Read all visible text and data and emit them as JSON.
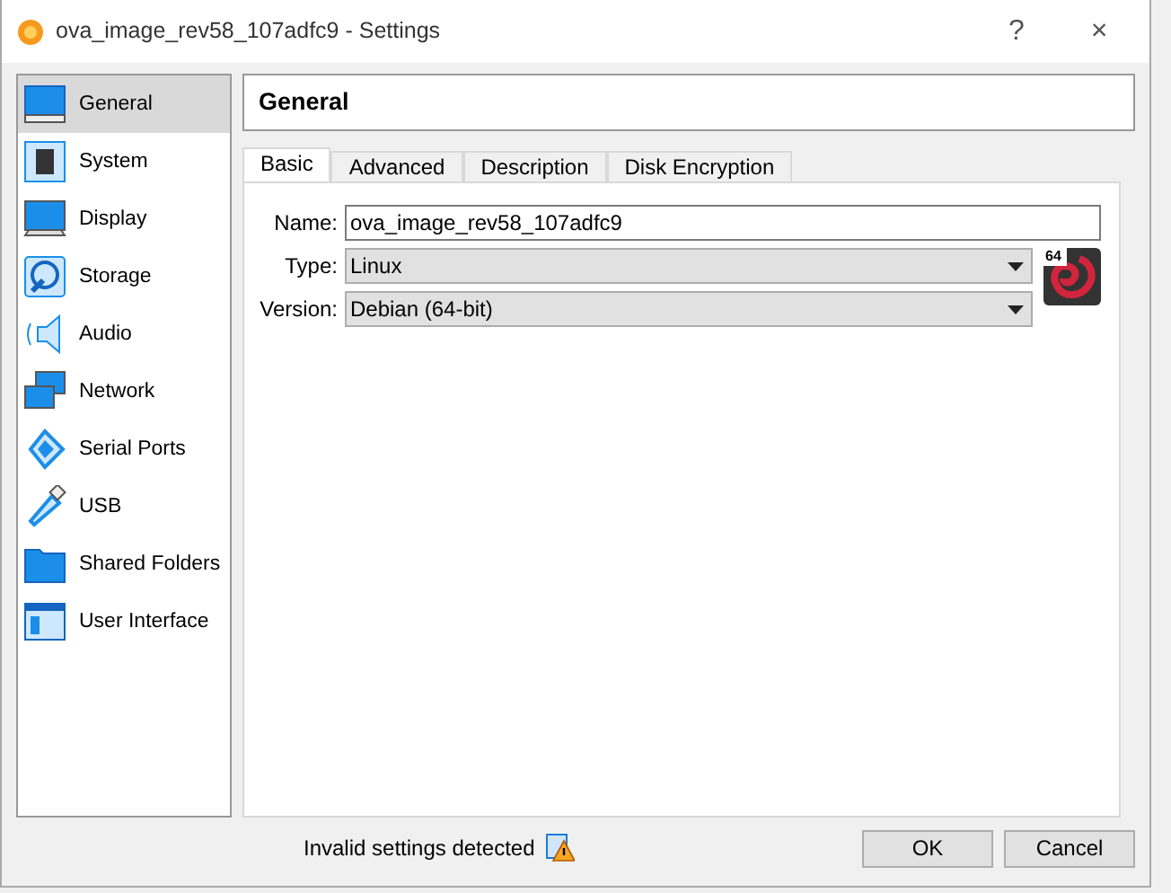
{
  "window": {
    "title": "ova_image_rev58_107adfc9 - Settings",
    "help": "?",
    "close": "×"
  },
  "sidebar": {
    "items": [
      {
        "label": "General",
        "selected": true
      },
      {
        "label": "System",
        "selected": false
      },
      {
        "label": "Display",
        "selected": false
      },
      {
        "label": "Storage",
        "selected": false
      },
      {
        "label": "Audio",
        "selected": false
      },
      {
        "label": "Network",
        "selected": false
      },
      {
        "label": "Serial Ports",
        "selected": false
      },
      {
        "label": "USB",
        "selected": false
      },
      {
        "label": "Shared Folders",
        "selected": false
      },
      {
        "label": "User Interface",
        "selected": false
      }
    ]
  },
  "page_title": "General",
  "tabs": [
    {
      "label": "Basic",
      "selected": true
    },
    {
      "label": "Advanced",
      "selected": false
    },
    {
      "label": "Description",
      "selected": false
    },
    {
      "label": "Disk Encryption",
      "selected": false
    }
  ],
  "fields": [
    {
      "kind": "text",
      "label": "Name:",
      "value": "ova_image_rev58_107adfc9"
    },
    {
      "kind": "select",
      "label": "Type:",
      "value": "Linux"
    },
    {
      "kind": "select",
      "label": "Version:",
      "value": "Debian (64-bit)"
    }
  ],
  "os_badge": "64",
  "status": "Invalid settings detected",
  "buttons": [
    "OK",
    "Cancel"
  ]
}
